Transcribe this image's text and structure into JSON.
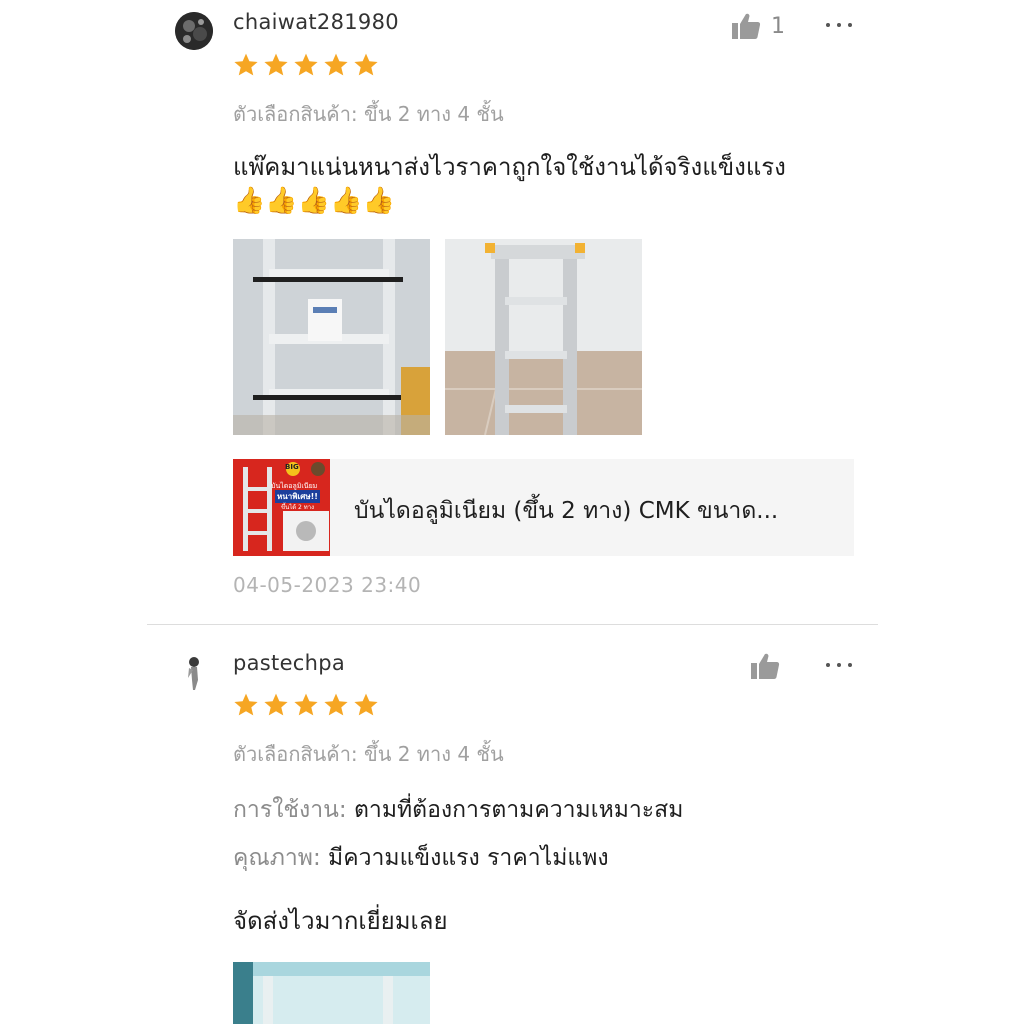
{
  "reviews": [
    {
      "username": "chaiwat281980",
      "like_count": "1",
      "rating": 5,
      "variant": "ตัวเลือกสินค้า: ขึ้น 2 ทาง 4 ชั้น",
      "comment": "แพ๊คมาแน่นหนาส่งไวราคาถูกใจใช้งานได้จริงแข็งแรง",
      "emoji": "👍👍👍👍👍",
      "photos": [
        "ladder-wrapped-photo",
        "ladder-unwrapped-photo"
      ],
      "product": {
        "name": "บันไดอลูมิเนียม (ขึ้น 2 ทาง) CMK ขนาด...",
        "thumb_badge": "BIG",
        "thumb_text_1": "บันไดอลูมิเนียม",
        "thumb_text_2": "หนาพิเศษ!!",
        "thumb_text_3": "ขึ้นได้ 2 ทาง"
      },
      "timestamp": "04-05-2023 23:40"
    },
    {
      "username": "pastechpa",
      "like_count": "",
      "rating": 5,
      "variant": "ตัวเลือกสินค้า: ขึ้น 2 ทาง 4 ชั้น",
      "attributes": [
        {
          "key": "การใช้งาน:",
          "value": "ตามที่ต้องการตามความเหมาะสม"
        },
        {
          "key": "คุณภาพ:",
          "value": "มีความแข็งแรง ราคาไม่แพง"
        }
      ],
      "comment": "จัดส่งไวมากเยี่ยมเลย"
    }
  ],
  "colors": {
    "star": "#f6a623",
    "muted_text": "#a0a0a0",
    "product_card_bg": "#f5f5f5",
    "product_thumb_bg": "#d7261e"
  },
  "icons": {
    "like": "thumbs-up-icon",
    "more": "more-options-icon",
    "star": "star-icon"
  }
}
